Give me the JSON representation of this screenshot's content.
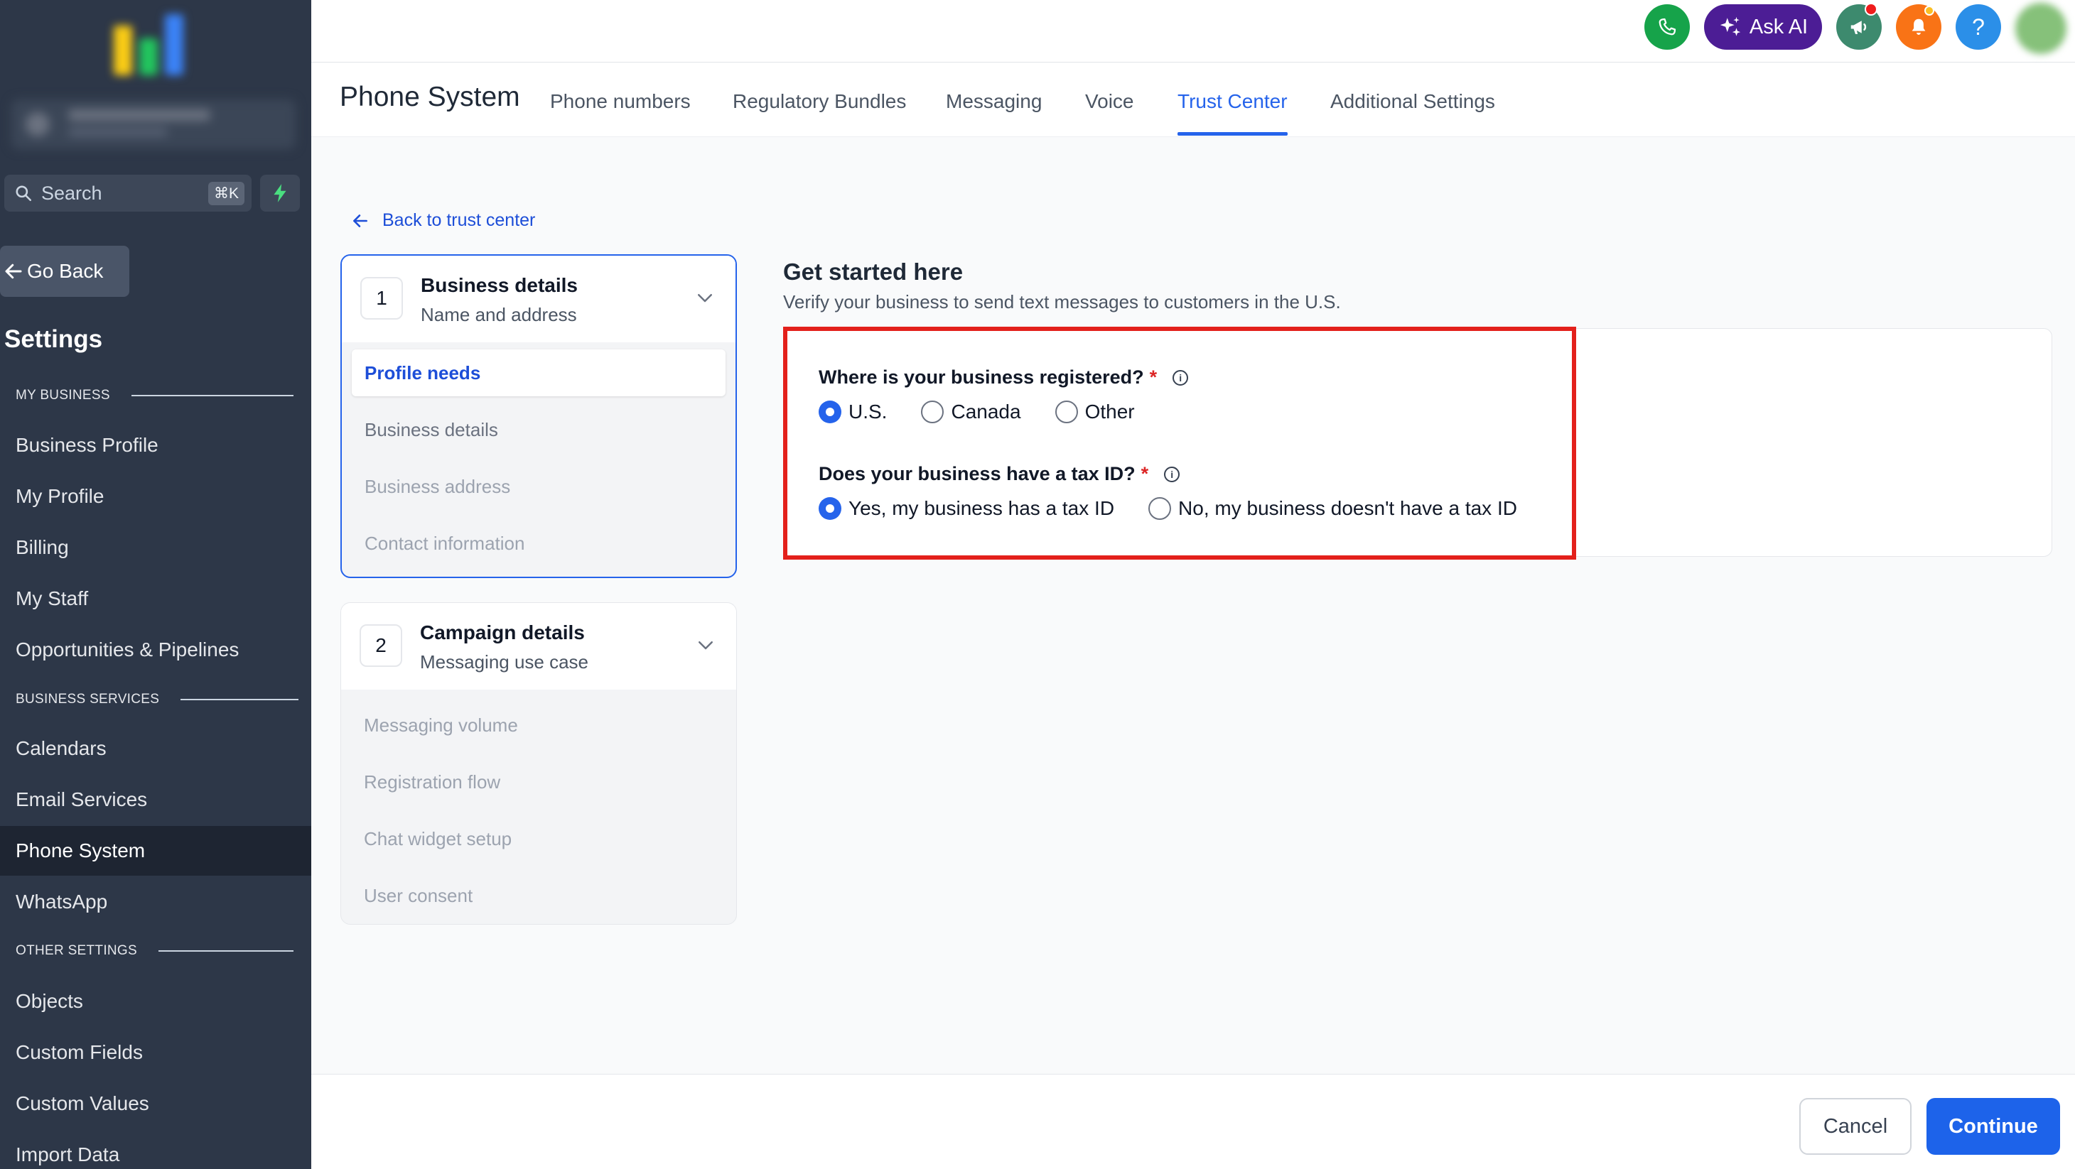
{
  "sidebar": {
    "search_placeholder": "Search",
    "search_shortcut": "⌘K",
    "go_back": "Go Back",
    "settings_title": "Settings",
    "sections": {
      "my_business": "MY BUSINESS",
      "business_services": "BUSINESS SERVICES",
      "other_settings": "OTHER SETTINGS"
    },
    "items": {
      "business_profile": "Business Profile",
      "my_profile": "My Profile",
      "billing": "Billing",
      "my_staff": "My Staff",
      "opportunities": "Opportunities & Pipelines",
      "calendars": "Calendars",
      "email_services": "Email Services",
      "phone_system": "Phone System",
      "whatsapp": "WhatsApp",
      "objects": "Objects",
      "custom_fields": "Custom Fields",
      "custom_values": "Custom Values",
      "import_data": "Import Data"
    },
    "active_item": "Phone System"
  },
  "topbar": {
    "ask_ai_label": "Ask AI",
    "help_label": "?",
    "icons": [
      "phone-icon",
      "sparkle-icon",
      "megaphone-icon",
      "bell-icon",
      "help-icon",
      "avatar"
    ],
    "colors": {
      "phone": "#16a34a",
      "ask_ai": "#4c1d95",
      "megaphone": "#3d8a6e",
      "bell": "#f97316",
      "help": "#2b8fe8"
    }
  },
  "header": {
    "page_title": "Phone System",
    "tabs": {
      "phone_numbers": "Phone numbers",
      "regulatory_bundles": "Regulatory Bundles",
      "messaging": "Messaging",
      "voice": "Voice",
      "trust_center": "Trust Center",
      "additional_settings": "Additional Settings"
    },
    "active_tab": "Trust Center"
  },
  "main": {
    "back_link": "Back to trust center",
    "steps": [
      {
        "number": "1",
        "title": "Business details",
        "subtitle": "Name and address",
        "substeps": [
          "Profile needs",
          "Business details",
          "Business address",
          "Contact information"
        ]
      },
      {
        "number": "2",
        "title": "Campaign details",
        "subtitle": "Messaging use case",
        "substeps": [
          "Messaging volume",
          "Registration flow",
          "Chat widget setup",
          "User consent"
        ]
      }
    ],
    "get_started_title": "Get started here",
    "get_started_subtitle": "Verify your business to send text messages to customers in the U.S.",
    "form": {
      "q1": {
        "label": "Where is your business registered?",
        "required_mark": "*",
        "options": [
          "U.S.",
          "Canada",
          "Other"
        ],
        "selected": "U.S."
      },
      "q2": {
        "label": "Does your business have a tax ID?",
        "required_mark": "*",
        "options": [
          "Yes, my business has a tax ID",
          "No, my business doesn't have a tax ID"
        ],
        "selected": "Yes, my business has a tax ID"
      }
    }
  },
  "footer": {
    "cancel_label": "Cancel",
    "continue_label": "Continue"
  },
  "colors": {
    "accent": "#2563eb",
    "sidebar_bg": "#2d3748",
    "highlight": "#e3201b"
  }
}
